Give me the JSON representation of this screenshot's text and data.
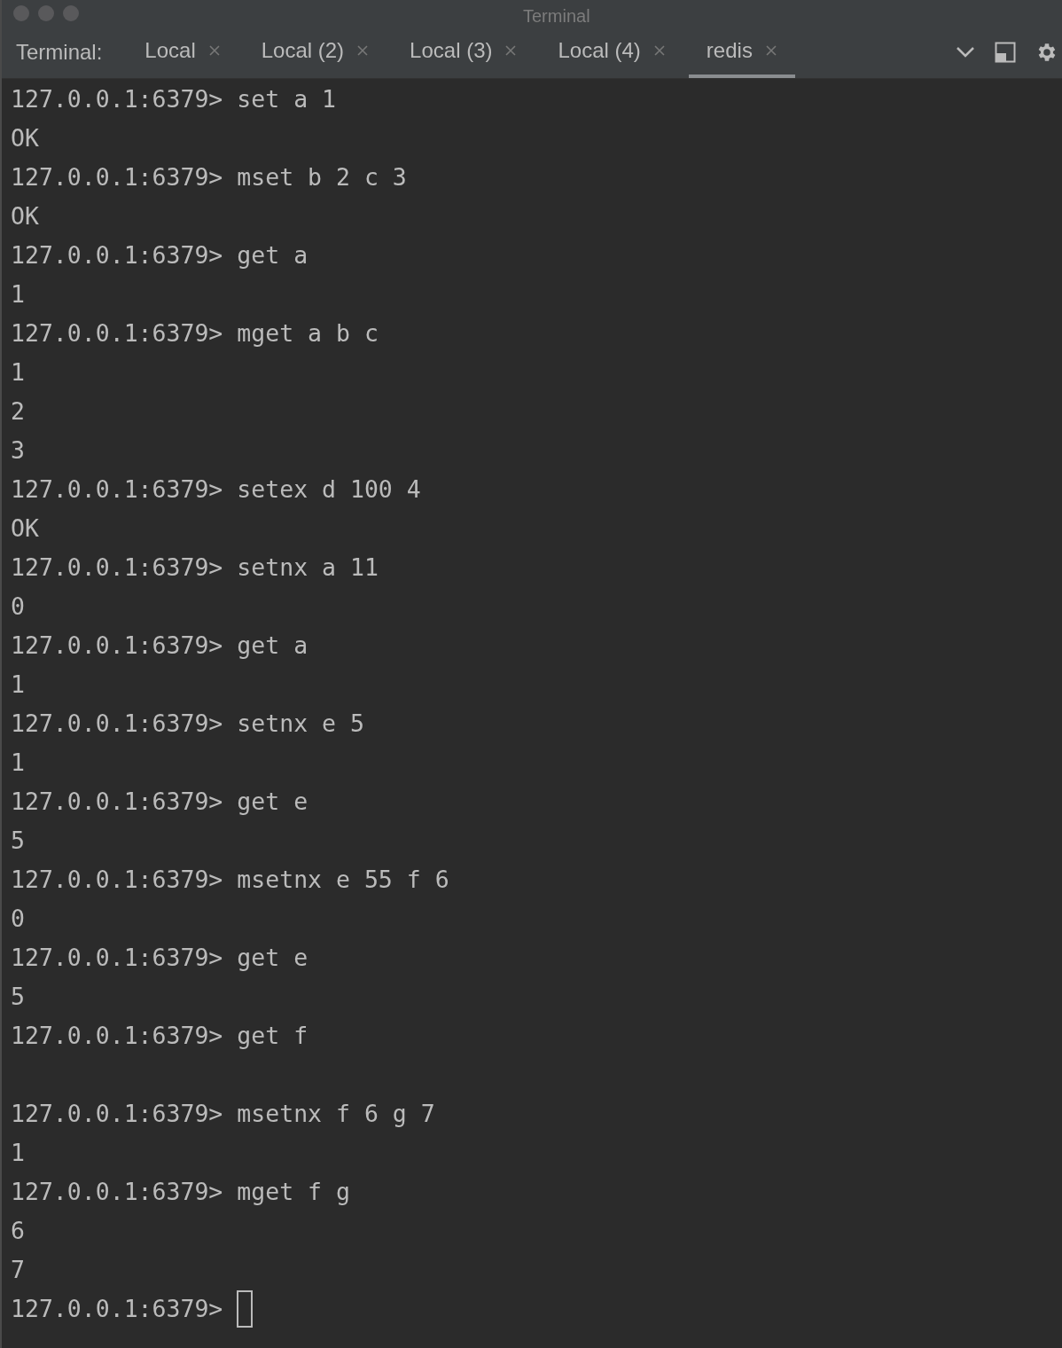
{
  "window": {
    "title": "Terminal"
  },
  "tool_window": {
    "label": "Terminal:",
    "tabs": [
      {
        "label": "Local",
        "selected": false
      },
      {
        "label": "Local (2)",
        "selected": false
      },
      {
        "label": "Local (3)",
        "selected": false
      },
      {
        "label": "Local (4)",
        "selected": false
      },
      {
        "label": "redis",
        "selected": true
      }
    ]
  },
  "terminal": {
    "lines": [
      {
        "kind": "prompt",
        "prompt": "127.0.0.1:6379>",
        "command": "set a 1"
      },
      {
        "kind": "output",
        "text": "OK"
      },
      {
        "kind": "prompt",
        "prompt": "127.0.0.1:6379>",
        "command": "mset b 2 c 3"
      },
      {
        "kind": "output",
        "text": "OK"
      },
      {
        "kind": "prompt",
        "prompt": "127.0.0.1:6379>",
        "command": "get a"
      },
      {
        "kind": "output",
        "text": "1"
      },
      {
        "kind": "prompt",
        "prompt": "127.0.0.1:6379>",
        "command": "mget a b c"
      },
      {
        "kind": "output",
        "text": "1"
      },
      {
        "kind": "output",
        "text": "2"
      },
      {
        "kind": "output",
        "text": "3"
      },
      {
        "kind": "prompt",
        "prompt": "127.0.0.1:6379>",
        "command": "setex d 100 4"
      },
      {
        "kind": "output",
        "text": "OK"
      },
      {
        "kind": "prompt",
        "prompt": "127.0.0.1:6379>",
        "command": "setnx a 11"
      },
      {
        "kind": "output",
        "text": "0"
      },
      {
        "kind": "prompt",
        "prompt": "127.0.0.1:6379>",
        "command": "get a"
      },
      {
        "kind": "output",
        "text": "1"
      },
      {
        "kind": "prompt",
        "prompt": "127.0.0.1:6379>",
        "command": "setnx e 5"
      },
      {
        "kind": "output",
        "text": "1"
      },
      {
        "kind": "prompt",
        "prompt": "127.0.0.1:6379>",
        "command": "get e"
      },
      {
        "kind": "output",
        "text": "5"
      },
      {
        "kind": "prompt",
        "prompt": "127.0.0.1:6379>",
        "command": "msetnx e 55 f 6"
      },
      {
        "kind": "output",
        "text": "0"
      },
      {
        "kind": "prompt",
        "prompt": "127.0.0.1:6379>",
        "command": "get e"
      },
      {
        "kind": "output",
        "text": "5"
      },
      {
        "kind": "prompt",
        "prompt": "127.0.0.1:6379>",
        "command": "get f"
      },
      {
        "kind": "blank"
      },
      {
        "kind": "prompt",
        "prompt": "127.0.0.1:6379>",
        "command": "msetnx f 6 g 7"
      },
      {
        "kind": "output",
        "text": "1"
      },
      {
        "kind": "prompt",
        "prompt": "127.0.0.1:6379>",
        "command": "mget f g"
      },
      {
        "kind": "output",
        "text": "6"
      },
      {
        "kind": "output",
        "text": "7"
      },
      {
        "kind": "prompt",
        "prompt": "127.0.0.1:6379>",
        "cursor": true
      }
    ]
  }
}
